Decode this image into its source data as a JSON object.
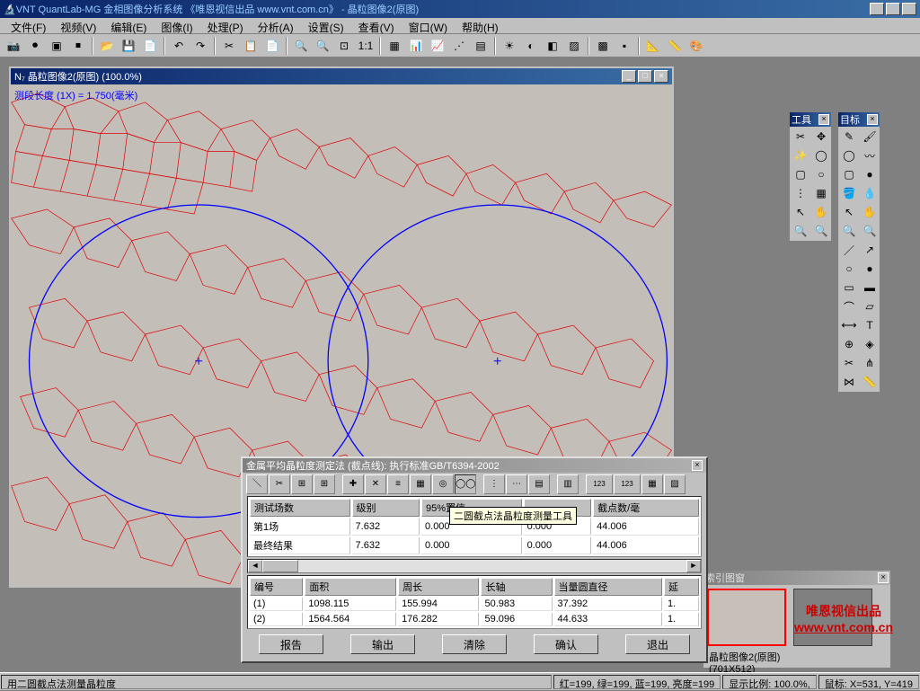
{
  "title": "VNT QuantLab-MG 金相图像分析系统 《唯恩视信出品 www.vnt.com.cn》 - 晶粒图像2(原图)",
  "menus": [
    "文件(F)",
    "视频(V)",
    "编辑(E)",
    "图像(I)",
    "处理(P)",
    "分析(A)",
    "设置(S)",
    "查看(V)",
    "窗口(W)",
    "帮助(H)"
  ],
  "imgwin": {
    "title": "N₇ 晶粒图像2(原图)  (100.0%)",
    "overlay": "测段长度 (1X) = 1.750(毫米)"
  },
  "toolpanel_title": "工具",
  "targetpanel_title": "目标",
  "dialog": {
    "title": "金属平均晶粒度测定法 (截点线):  执行标准GB/T6394-2002",
    "tooltip": "二圆截点法晶粒度测量工具",
    "table1": {
      "headers": [
        "测试场数",
        "级别",
        "95%置信",
        "",
        "截点数/毫"
      ],
      "rows": [
        [
          "第1场",
          "7.632",
          "0.000",
          "0.000",
          "44.006"
        ],
        [
          "最终结果",
          "7.632",
          "0.000",
          "0.000",
          "44.006"
        ]
      ]
    },
    "table2": {
      "headers": [
        "编号",
        "面积",
        "周长",
        "长轴",
        "当量圆直径",
        "延"
      ],
      "rows": [
        [
          "(1)",
          "1098.115",
          "155.994",
          "50.983",
          "37.392",
          "1."
        ],
        [
          "(2)",
          "1564.564",
          "176.282",
          "59.096",
          "44.633",
          "1."
        ]
      ]
    },
    "buttons": [
      "报告",
      "输出",
      "清除",
      "确认",
      "退出"
    ]
  },
  "indexpanel": {
    "title": "索引图窗",
    "label1": "晶粒图像2(原图)",
    "label2": "(701X512)"
  },
  "watermark": {
    "l1": "唯恩视信出品",
    "l2": "www.vnt.com.cn"
  },
  "status": {
    "left": "用二圆截点法测量晶粒度",
    "mid": "红=199, 绿=199, 蓝=199, 亮度=199",
    "r1": "显示比例: 100.0%,",
    "r2": "鼠标: X=531, Y=419"
  }
}
